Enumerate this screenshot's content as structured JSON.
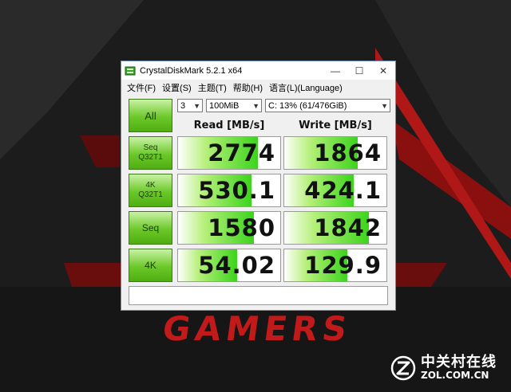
{
  "window": {
    "title": "CrystalDiskMark 5.2.1 x64",
    "controls": {
      "minimize": "—",
      "maximize": "☐",
      "close": "✕"
    }
  },
  "menu": [
    {
      "label": "文件(F)"
    },
    {
      "label": "设置(S)"
    },
    {
      "label": "主题(T)"
    },
    {
      "label": "帮助(H)"
    },
    {
      "label": "语言(L)(Language)"
    }
  ],
  "settings": {
    "count": "3",
    "size": "100MiB",
    "drive": "C: 13% (61/476GiB)"
  },
  "all_button": "All",
  "columns": {
    "read": "Read [MB/s]",
    "write": "Write [MB/s]"
  },
  "rows": [
    {
      "label_line1": "Seq",
      "label_line2": "Q32T1",
      "read": "2774",
      "write": "1864",
      "read_fill": 0.78,
      "write_fill": 0.72
    },
    {
      "label_line1": "4K",
      "label_line2": "Q32T1",
      "read": "530.1",
      "write": "424.1",
      "read_fill": 0.72,
      "write_fill": 0.68
    },
    {
      "label_line1": "Seq",
      "label_line2": "",
      "read": "1580",
      "write": "1842",
      "read_fill": 0.74,
      "write_fill": 0.83
    },
    {
      "label_line1": "4K",
      "label_line2": "",
      "read": "54.02",
      "write": "129.9",
      "read_fill": 0.58,
      "write_fill": 0.62
    }
  ],
  "comment": "",
  "wallpaper": {
    "brand_text": "GAMERS",
    "accent_color": "#c01a1a"
  },
  "watermark": {
    "cn": "中关村在线",
    "en": "ZOL.COM.CN"
  }
}
